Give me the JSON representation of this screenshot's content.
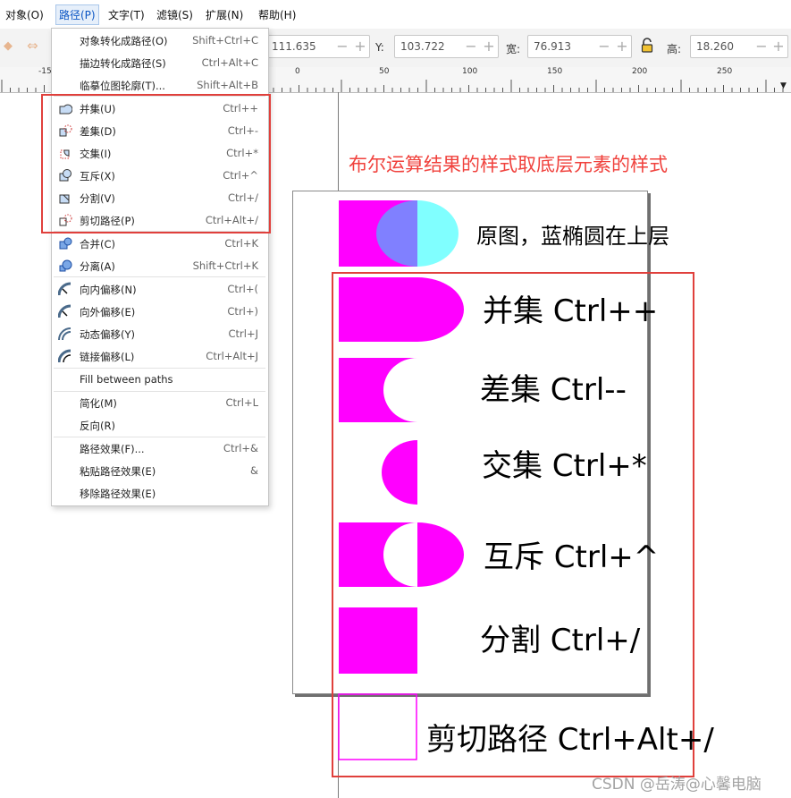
{
  "menubar": {
    "items": [
      "对象(O)",
      "路径(P)",
      "文字(T)",
      "滤镜(S)",
      "扩展(N)",
      "帮助(H)"
    ],
    "active_index": 1
  },
  "toolbar": {
    "x_value": "111.635",
    "y_label": "Y:",
    "y_value": "103.722",
    "w_label": "宽:",
    "w_value": "76.913",
    "h_label": "高:",
    "h_value": "18.260",
    "minus": "−",
    "plus": "+",
    "lock_icon": "lock-icon"
  },
  "ruler": {
    "labels": [
      "-15",
      "0",
      "50",
      "100",
      "150",
      "200",
      "250"
    ]
  },
  "path_menu": {
    "items": [
      {
        "label": "对象转化成路径(O)",
        "shortcut": "Shift+Ctrl+C",
        "icon": ""
      },
      {
        "label": "描边转化成路径(S)",
        "shortcut": "Ctrl+Alt+C",
        "icon": ""
      },
      {
        "label": "临摹位图轮廓(T)...",
        "shortcut": "Shift+Alt+B",
        "icon": ""
      },
      {
        "label": "并集(U)",
        "shortcut": "Ctrl++",
        "icon": "union-icon"
      },
      {
        "label": "差集(D)",
        "shortcut": "Ctrl+-",
        "icon": "difference-icon"
      },
      {
        "label": "交集(I)",
        "shortcut": "Ctrl+*",
        "icon": "intersection-icon"
      },
      {
        "label": "互斥(X)",
        "shortcut": "Ctrl+^",
        "icon": "exclusion-icon"
      },
      {
        "label": "分割(V)",
        "shortcut": "Ctrl+/",
        "icon": "division-icon"
      },
      {
        "label": "剪切路径(P)",
        "shortcut": "Ctrl+Alt+/",
        "icon": "cut-path-icon"
      },
      {
        "label": "合并(C)",
        "shortcut": "Ctrl+K",
        "icon": "combine-icon"
      },
      {
        "label": "分离(A)",
        "shortcut": "Shift+Ctrl+K",
        "icon": "break-apart-icon"
      },
      {
        "label": "向内偏移(N)",
        "shortcut": "Ctrl+(",
        "icon": "inset-icon"
      },
      {
        "label": "向外偏移(E)",
        "shortcut": "Ctrl+)",
        "icon": "outset-icon"
      },
      {
        "label": "动态偏移(Y)",
        "shortcut": "Ctrl+J",
        "icon": "dynamic-offset-icon"
      },
      {
        "label": "链接偏移(L)",
        "shortcut": "Ctrl+Alt+J",
        "icon": "linked-offset-icon"
      },
      {
        "label": "Fill between paths",
        "shortcut": "",
        "icon": ""
      },
      {
        "label": "简化(M)",
        "shortcut": "Ctrl+L",
        "icon": ""
      },
      {
        "label": "反向(R)",
        "shortcut": "",
        "icon": ""
      },
      {
        "label": "路径效果(F)...",
        "shortcut": "Ctrl+&",
        "icon": ""
      },
      {
        "label": "粘贴路径效果(E)",
        "shortcut": "&",
        "icon": ""
      },
      {
        "label": "移除路径效果(E)",
        "shortcut": "",
        "icon": ""
      }
    ]
  },
  "annotation": {
    "note": "布尔运算结果的样式取底层元素的样式"
  },
  "demos": {
    "original": "原图，蓝椭圆在上层",
    "union": "并集 Ctrl++",
    "difference": "差集 Ctrl--",
    "intersection": "交集 Ctrl+*",
    "exclusion": "互斥 Ctrl+^",
    "division": "分割 Ctrl+/",
    "cut_path": "剪切路径 Ctrl+Alt+/"
  },
  "colors": {
    "magenta": "#ff00ff",
    "cyan": "#80ffff",
    "overlap": "#8080ff",
    "highlight": "#e0403c"
  },
  "watermark": "CSDN @岳涛@心馨电脑"
}
